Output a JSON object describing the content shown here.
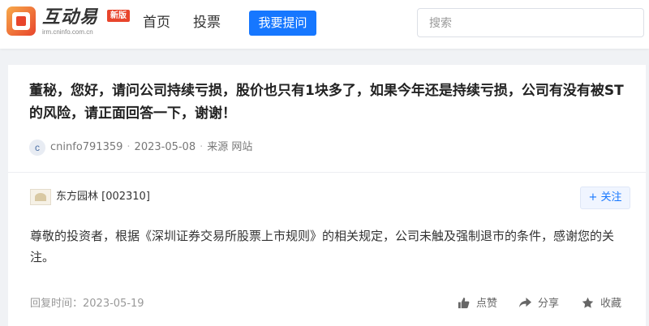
{
  "header": {
    "logo_text": "互动易",
    "logo_sub": "irm.cninfo.com.cn",
    "logo_badge": "新版",
    "nav": {
      "home": "首页",
      "vote": "投票"
    },
    "ask_label": "我要提问",
    "search_placeholder": "搜索"
  },
  "question": {
    "text": "董秘，您好，请问公司持续亏损，股价也只有1块多了，如果今年还是持续亏损，公司有没有被ST的风险，请正面回答一下，谢谢！",
    "avatar_letter": "c",
    "user": "cninfo791359",
    "separator": "·",
    "date": "2023-05-08",
    "source": "来源 网站"
  },
  "answer": {
    "company": "东方园林 [002310]",
    "follow_plus": "+",
    "follow_label": "关注",
    "text": "尊敬的投资者，根据《深圳证券交易所股票上市规则》的相关规定，公司未触及强制退市的条件，感谢您的关注。",
    "reply_time": "回复时间：2023-05-19",
    "actions": {
      "like": "点赞",
      "share": "分享",
      "favorite": "收藏"
    }
  },
  "colors": {
    "accent": "#1677ff",
    "brand_red": "#e8452c",
    "page_bg": "#f0f2f5"
  },
  "icons": {
    "like": "thumbs-up-icon",
    "share": "share-arrow-icon",
    "favorite": "star-icon",
    "logo": "cninfo-logo-icon"
  }
}
